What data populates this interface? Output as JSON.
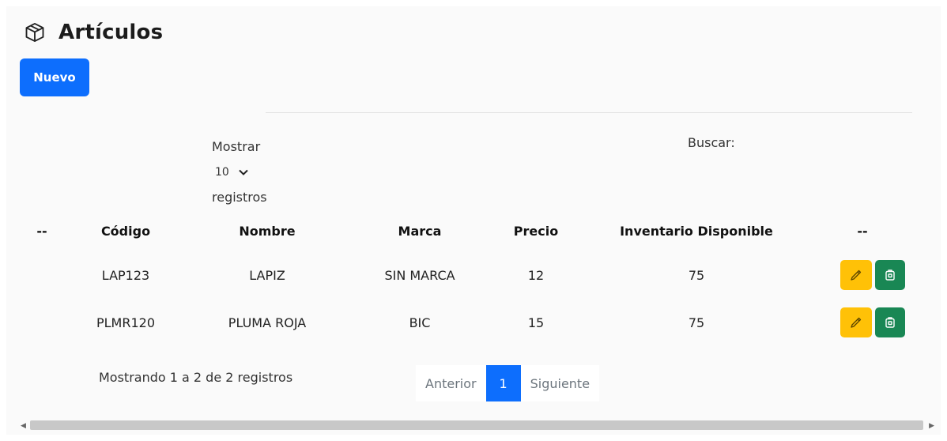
{
  "page": {
    "title": "Artículos",
    "title_icon": "box-icon"
  },
  "toolbar": {
    "new_label": "Nuevo",
    "accent_color": "#0d6efd"
  },
  "length_control": {
    "label_before": "Mostrar",
    "selected": "10",
    "label_after": "registros"
  },
  "search": {
    "label": "Buscar:"
  },
  "table": {
    "headers": [
      "--",
      "Código",
      "Nombre",
      "Marca",
      "Precio",
      "Inventario Disponible",
      "--"
    ],
    "rows": [
      {
        "code": "LAP123",
        "name": "LAPIZ",
        "brand": "SIN MARCA",
        "price": "12",
        "stock": "75"
      },
      {
        "code": "PLMR120",
        "name": "PLUMA ROJA",
        "brand": "BIC",
        "price": "15",
        "stock": "75"
      }
    ],
    "row_actions": {
      "edit_icon": "pencil-icon",
      "edit_color": "#ffc107",
      "delete_icon": "trash-icon",
      "delete_color": "#198754"
    }
  },
  "info": "Mostrando 1 a 2 de 2 registros",
  "pagination": {
    "previous": "Anterior",
    "current": "1",
    "next": "Siguiente"
  }
}
